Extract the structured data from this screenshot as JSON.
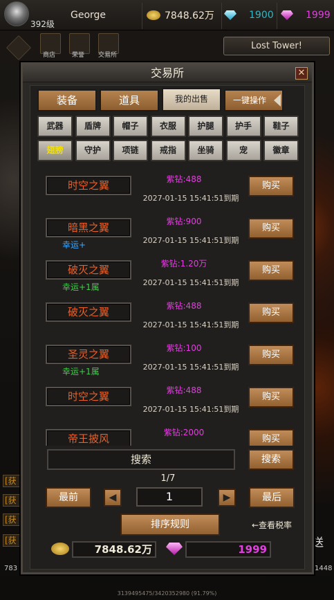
{
  "player": {
    "name": "George",
    "level": "392级"
  },
  "resources": {
    "gold": "7848.62万",
    "blue_gem": "1900",
    "purple_gem": "1999"
  },
  "toolbar": {
    "shop": "商店",
    "honor": "荣誉",
    "exchange": "交易所"
  },
  "tower_button": "Lost  Tower!",
  "dialog": {
    "title": "交易所",
    "close": "✕"
  },
  "tabs": [
    {
      "label": "装备"
    },
    {
      "label": "道具"
    },
    {
      "label": "我的出售"
    },
    {
      "label": "一键操作"
    }
  ],
  "categories": [
    "武器",
    "盾牌",
    "帽子",
    "衣服",
    "护腿",
    "护手",
    "鞋子",
    "翅膀",
    "守护",
    "项链",
    "戒指",
    "坐骑",
    "宠",
    "徽章"
  ],
  "listings": [
    {
      "name": "时空之翼",
      "sub": "",
      "price": "紫钻:488",
      "date": "2027-01-15  15:41:51到期",
      "buy": "购买"
    },
    {
      "name": "暗黑之翼",
      "sub": "幸运+",
      "price": "紫钻:900",
      "date": "2027-01-15  15:41:51到期",
      "buy": "购买"
    },
    {
      "name": "破灭之翼",
      "sub": "幸运+1属",
      "price": "紫钻:1.20万",
      "date": "2027-01-15  15:41:51到期",
      "buy": "购买"
    },
    {
      "name": "破灭之翼",
      "sub": "",
      "price": "紫钻:488",
      "date": "2027-01-15  15:41:51到期",
      "buy": "购买"
    },
    {
      "name": "圣灵之翼",
      "sub": "幸运+1属",
      "price": "紫钻:100",
      "date": "2027-01-15  15:41:51到期",
      "buy": "购买"
    },
    {
      "name": "时空之翼",
      "sub": "",
      "price": "紫钻:488",
      "date": "2027-01-15  15:41:51到期",
      "buy": "购买"
    },
    {
      "name": "帝王披风",
      "sub": "",
      "price": "紫钻:2000",
      "date": "",
      "buy": "购买"
    }
  ],
  "search": {
    "field": "搜索",
    "button": "搜索"
  },
  "pagination": {
    "page_info": "1/7",
    "first": "最前",
    "last": "最后",
    "current": "1",
    "prev_icon": "◀",
    "next_icon": "▶"
  },
  "sort_button": "排序规则",
  "tax_link": "←查看税率",
  "bottom": {
    "gold": "7848.62万",
    "purple_gem": "1999"
  },
  "side": {
    "chat_tag": "[获",
    "send": "送",
    "hp_left": "783",
    "hp_right": "1448"
  },
  "footer": "3139495475/3420352980 (91.79%)",
  "colors": {
    "gold": "#f4d06a",
    "blue": "#2fb8c8",
    "purple": "#e23ee0",
    "orange": "#e8602a",
    "luck_blue": "#3aa9ff",
    "luck_green": "#3ed04a"
  }
}
